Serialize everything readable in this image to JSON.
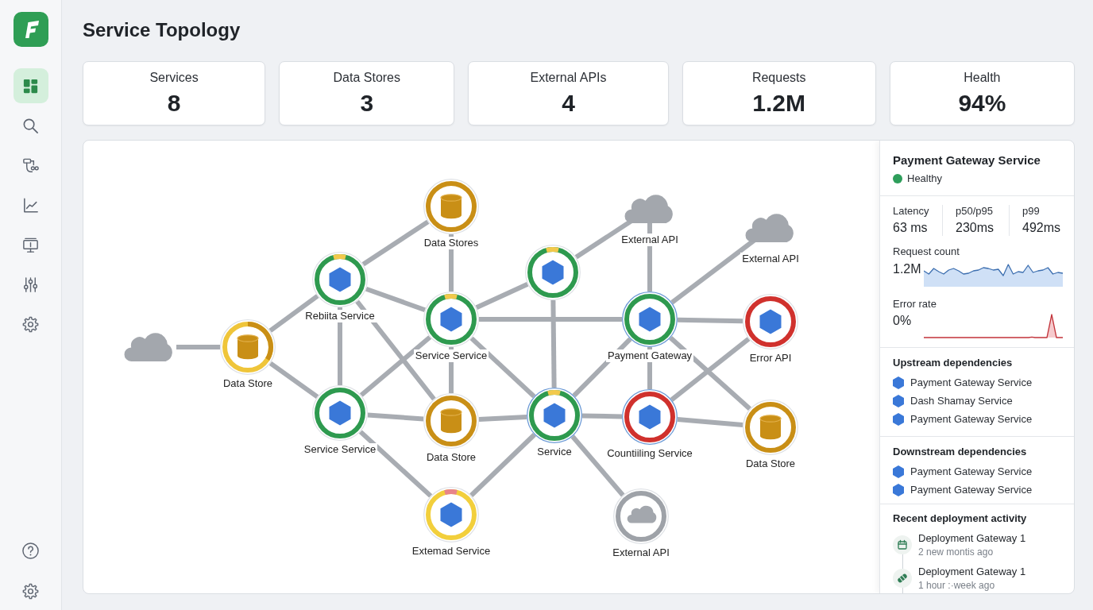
{
  "sidebar": {
    "items": [
      {
        "selected": true
      },
      {
        "selected": false
      },
      {
        "selected": false
      },
      {
        "selected": false
      },
      {
        "selected": false
      },
      {
        "selected": false
      },
      {
        "selected": false
      }
    ]
  },
  "title": "Service Topology",
  "stats": [
    {
      "label": "Services",
      "value": "8"
    },
    {
      "label": "Data Stores",
      "value": "3"
    },
    {
      "label": "External APIs",
      "value": "4"
    },
    {
      "label": "Requests",
      "value": "1.2M"
    },
    {
      "label": "Health",
      "value": "94%"
    }
  ],
  "topology": {
    "nodes": [
      {
        "kind": "cloud",
        "highlighted": false
      },
      {
        "kind": "store",
        "label": "Data Store",
        "color": "#efc53a",
        "arc": {
          "color": "#c98f16"
        },
        "highlighted": false
      },
      {
        "kind": "service",
        "label": "Rebiita Service",
        "color": "#2e9a4f",
        "arc": {
          "color": "#f2c94c"
        },
        "highlighted": false
      },
      {
        "kind": "store",
        "label": "Data Stores",
        "color": "#c98f16",
        "highlighted": false
      },
      {
        "kind": "service",
        "label": "Service Service",
        "color": "#2e9a4f",
        "arc": {
          "color": "#f2c94c"
        },
        "highlighted": false
      },
      {
        "kind": "service",
        "label": "Service Service",
        "color": "#2e9a4f",
        "highlighted": false
      },
      {
        "kind": "store",
        "label": "Data Store",
        "color": "#c98f16",
        "highlighted": false
      },
      {
        "kind": "service",
        "label": "Extemad Service",
        "color": "#f2cf3c",
        "arc": {
          "color": "#e8848a"
        },
        "highlighted": false
      },
      {
        "kind": "service",
        "color": "#2e9a4f",
        "arc": {
          "color": "#f2c94c"
        },
        "highlighted": false
      },
      {
        "kind": "cloud",
        "label": "External API",
        "highlighted": false
      },
      {
        "kind": "cloud",
        "label": "External API",
        "highlighted": false
      },
      {
        "kind": "service",
        "label": "Payment Gateway",
        "color": "#2e9a4f",
        "highlighted": true
      },
      {
        "kind": "service",
        "label": "Error API",
        "color": "#d0312d",
        "highlighted": false
      },
      {
        "kind": "service",
        "label": "Service",
        "color": "#2e9a4f",
        "arc": {
          "color": "#f2c94c"
        },
        "highlighted": true
      },
      {
        "kind": "service",
        "label": "Countiiling Service",
        "color": "#d0312d",
        "highlighted": true
      },
      {
        "kind": "store",
        "label": "Data Store",
        "color": "#c98f16",
        "highlighted": false
      },
      {
        "kind": "cloud",
        "label": "External API",
        "color": "#9ea2a8",
        "highlighted": false
      }
    ]
  },
  "details": {
    "title": "Payment Gateway Service",
    "status": {
      "kind": "healthy",
      "label": "Healthy"
    },
    "metrics": [
      {
        "label": "Latency",
        "value": "63 ms"
      },
      {
        "label": "p50/p95",
        "value": "230ms"
      },
      {
        "label": "p99",
        "value": "492ms"
      }
    ],
    "request_count": {
      "label": "Request count",
      "value": "1.2M"
    },
    "error_rate": {
      "label": "Error rate",
      "value": "0%"
    },
    "upstream": {
      "title": "Upstream dependencies",
      "items": [
        "Payment Gateway Service",
        "Dash Shamay Service",
        "Payment Gateway Service"
      ]
    },
    "downstream": {
      "title": "Downstream dependencies",
      "items": [
        "Payment Gateway Service",
        "Payment Gateway Service"
      ]
    },
    "activity": {
      "title": "Recent deployment activity",
      "items": [
        {
          "title": "Deployment Gateway 1",
          "time": "2 new montis ago"
        },
        {
          "title": "Deployment Gateway 1",
          "time": "1 hour :·week ago"
        }
      ]
    }
  }
}
